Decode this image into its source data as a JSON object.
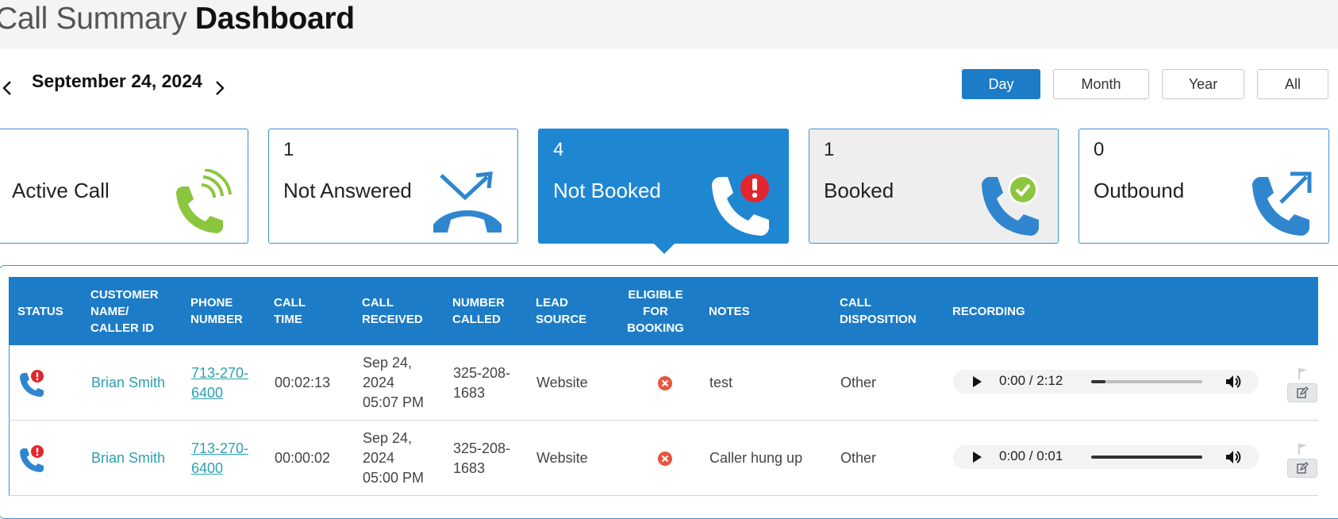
{
  "header": {
    "title_light": "Call Summary",
    "title_bold": "Dashboard"
  },
  "datebar": {
    "prev_icon": "chevron-left-icon",
    "next_icon": "chevron-right-icon",
    "date": "September 24, 2024",
    "periods": [
      "Day",
      "Month",
      "Year",
      "All"
    ],
    "active_period": "Day"
  },
  "cards": [
    {
      "count": "",
      "label": "Active Call",
      "icon": "phone-ringing-icon",
      "icon_color": "#8cc63f"
    },
    {
      "count": "1",
      "label": "Not Answered",
      "icon": "missed-call-icon",
      "icon_color": "#2f86cf"
    },
    {
      "count": "4",
      "label": "Not Booked",
      "icon": "phone-alert-icon",
      "icon_color": "#ffffff"
    },
    {
      "count": "1",
      "label": "Booked",
      "icon": "phone-check-icon",
      "icon_color": "#2f86cf"
    },
    {
      "count": "0",
      "label": "Outbound",
      "icon": "outbound-call-icon",
      "icon_color": "#2f86cf"
    }
  ],
  "colors": {
    "accent": "#1d7cc7",
    "link": "#2f9fb0",
    "alert": "#e3262e",
    "success": "#8cc63f"
  },
  "table": {
    "headers": {
      "status": "STATUS",
      "customer": [
        "CUSTOMER",
        "NAME/",
        "CALLER ID"
      ],
      "phone": [
        "PHONE",
        "NUMBER"
      ],
      "call_time": [
        "CALL",
        "TIME"
      ],
      "call_received": [
        "CALL",
        "RECEIVED"
      ],
      "number_called": [
        "NUMBER",
        "CALLED"
      ],
      "lead_source": [
        "LEAD",
        "SOURCE"
      ],
      "eligible": [
        "ELIGIBLE",
        "FOR",
        "BOOKING"
      ],
      "notes": "NOTES",
      "disposition": [
        "CALL",
        "DISPOSITION"
      ],
      "recording": "RECORDING"
    },
    "rows": [
      {
        "status_icon": "phone-alert-icon",
        "customer": "Brian Smith",
        "phone": [
          "713-270-",
          "6400"
        ],
        "call_time": "00:02:13",
        "received": [
          "Sep 24,",
          "2024",
          "05:07 PM"
        ],
        "number_called": [
          "325-208-",
          "1683"
        ],
        "lead_source": "Website",
        "eligible_icon": "x-circle-icon",
        "notes": "test",
        "disposition": "Other",
        "recording_time": "0:00 / 2:12",
        "recording_progress": 0.13
      },
      {
        "status_icon": "phone-alert-icon",
        "customer": "Brian Smith",
        "phone": [
          "713-270-",
          "6400"
        ],
        "call_time": "00:00:02",
        "received": [
          "Sep 24,",
          "2024",
          "05:00 PM"
        ],
        "number_called": [
          "325-208-",
          "1683"
        ],
        "lead_source": "Website",
        "eligible_icon": "x-circle-icon",
        "notes": "Caller hung up",
        "disposition": "Other",
        "recording_time": "0:00 / 0:01",
        "recording_progress": 1.0
      }
    ]
  }
}
